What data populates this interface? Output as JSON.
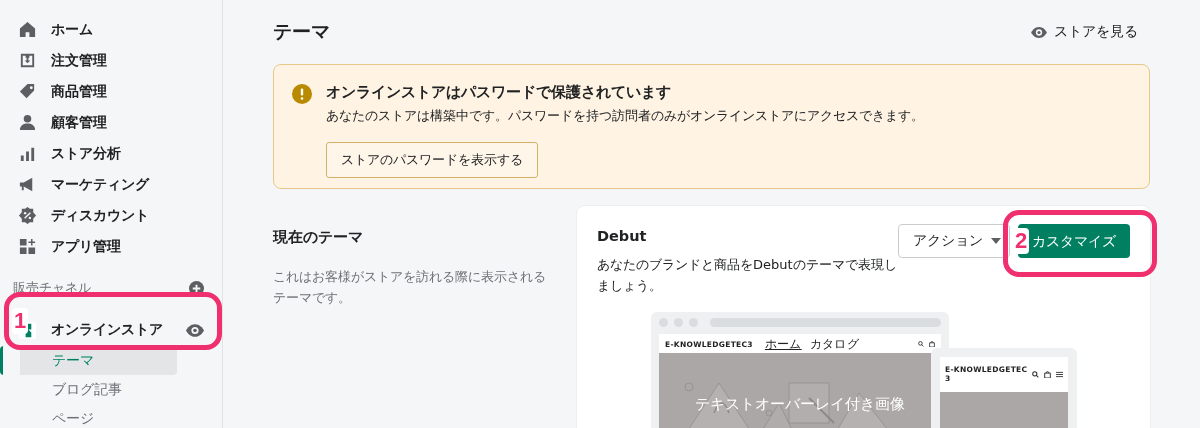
{
  "sidebar": {
    "items": [
      {
        "label": "ホーム"
      },
      {
        "label": "注文管理"
      },
      {
        "label": "商品管理"
      },
      {
        "label": "顧客管理"
      },
      {
        "label": "ストア分析"
      },
      {
        "label": "マーケティング"
      },
      {
        "label": "ディスカウント"
      },
      {
        "label": "アプリ管理"
      }
    ],
    "section_label": "販売チャネル",
    "channel": {
      "label": "オンラインストア",
      "children": [
        {
          "label": "テーマ",
          "selected": true
        },
        {
          "label": "ブログ記事",
          "selected": false
        },
        {
          "label": "ページ",
          "selected": false
        }
      ]
    }
  },
  "page": {
    "title": "テーマ",
    "view_store_link": "ストアを見る"
  },
  "banner": {
    "title": "オンラインストアはパスワードで保護されています",
    "message": "あなたのストアは構築中です。パスワードを持つ訪問者のみがオンラインストアにアクセスできます。",
    "button": "ストアのパスワードを表示する"
  },
  "current_theme": {
    "heading": "現在のテーマ",
    "description": "これはお客様がストアを訪れる際に表示されるテーマです。"
  },
  "theme_card": {
    "name": "Debut",
    "description": "あなたのブランドと商品をDebutのテーマで表現しましょう。",
    "action_button": "アクション",
    "customize_button": "カスタマイズ",
    "preview": {
      "desktop": {
        "store_name": "E-KNOWLEDGETEC3",
        "nav": [
          {
            "label": "ホーム",
            "selected": true
          },
          {
            "label": "カタログ",
            "selected": false
          }
        ],
        "hero_text": "テキストオーバーレイ付き画像"
      },
      "mobile": {
        "store_name": "E-KNOWLEDGETEC3"
      }
    }
  },
  "annotations": [
    {
      "label": "1"
    },
    {
      "label": "2"
    }
  ]
}
